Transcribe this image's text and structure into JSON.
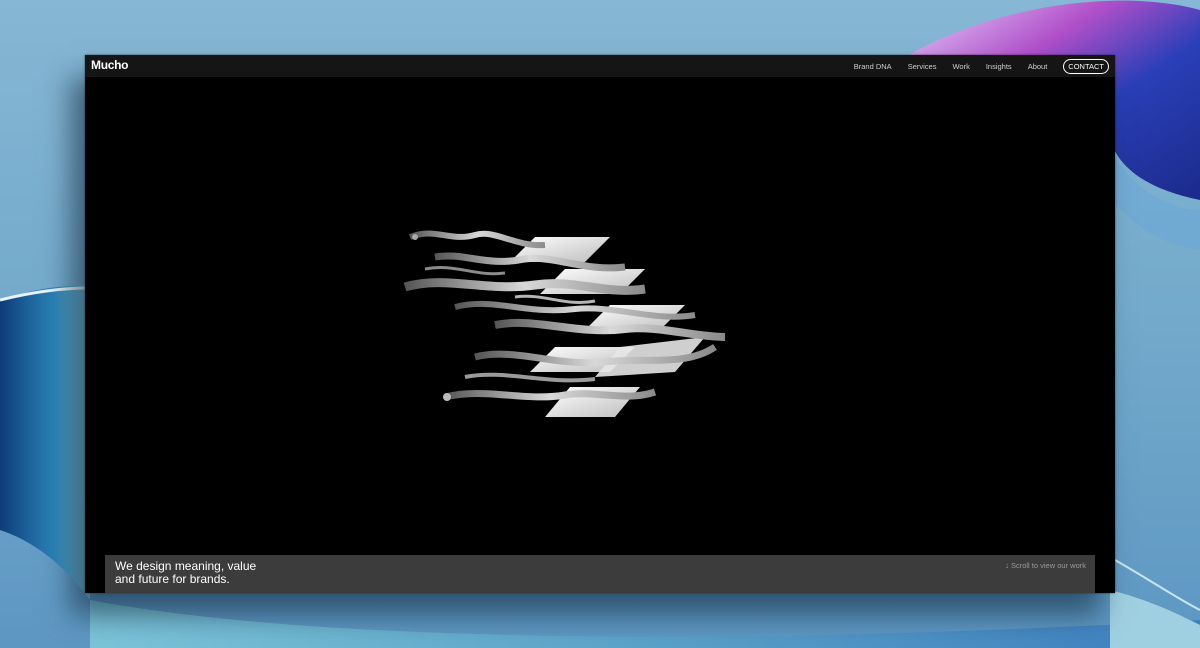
{
  "brand": {
    "logo": "Mucho"
  },
  "nav": {
    "items": [
      "Brand DNA",
      "Services",
      "Work",
      "Insights",
      "About"
    ],
    "contact": "CONTACT"
  },
  "hero": {
    "headline_line1": "We design meaning, value",
    "headline_line2": "and future for brands.",
    "scroll_hint": "Scroll to view our work"
  },
  "colors": {
    "page_background": "#000000",
    "navbar": "#151515",
    "tagline_bar": "#3c3c3c",
    "desktop_blue": "#6ea4c8"
  }
}
